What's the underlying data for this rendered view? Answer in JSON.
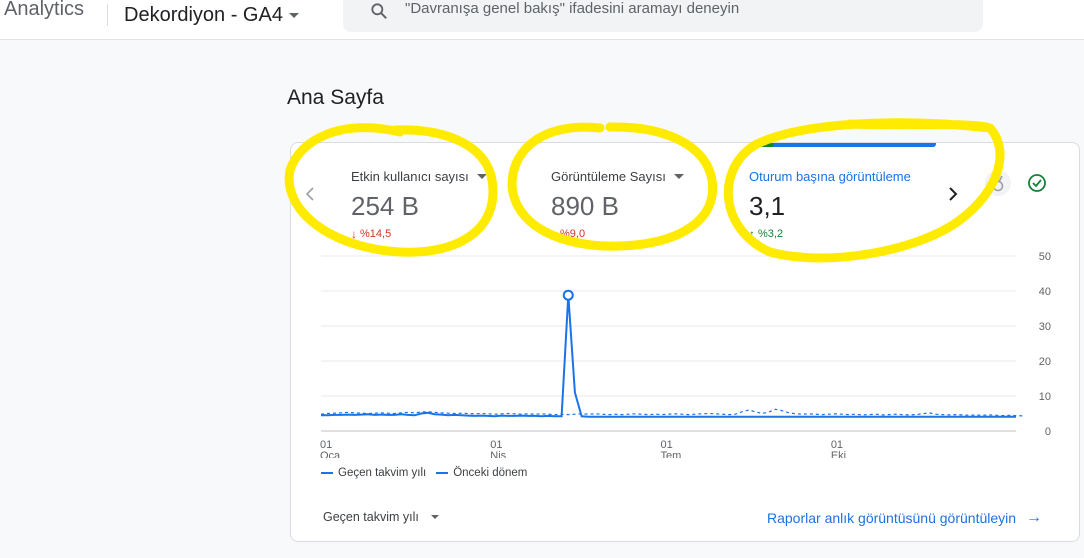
{
  "header": {
    "brand": "Analytics",
    "property_name": "Dekordiyon - GA4",
    "search_placeholder": "\"Davranışa genel bakış\" ifadesini aramayı deneyin"
  },
  "page": {
    "title": "Ana Sayfa"
  },
  "metrics": [
    {
      "label": "Etkin kullanıcı sayısı",
      "value": "254 B",
      "change": "%14,5",
      "direction": "down"
    },
    {
      "label": "Görüntüleme Sayısı",
      "value": "890 B",
      "change": "%9,0",
      "direction": "down"
    },
    {
      "label": "Oturum başına görüntüleme",
      "value": "3,1",
      "change": "%3,2",
      "direction": "up"
    }
  ],
  "chart_data": {
    "type": "line",
    "x_ticks": [
      {
        "day": "01",
        "month": "Oca"
      },
      {
        "day": "01",
        "month": "Nis"
      },
      {
        "day": "01",
        "month": "Tem"
      },
      {
        "day": "01",
        "month": "Eki"
      }
    ],
    "y_ticks": [
      "50",
      "40",
      "30",
      "20",
      "10",
      "0"
    ],
    "ylim": [
      0,
      50
    ],
    "grid": true,
    "legend_placement": "bottom-left",
    "series": [
      {
        "name": "Geçen takvim yılı",
        "style": "solid",
        "color": "#1a73e8",
        "values": [
          4.5,
          4.5,
          4.6,
          4.6,
          4.7,
          4.6,
          4.7,
          4.8,
          4.6,
          4.7,
          4.6,
          4.6,
          4.8,
          4.6,
          4.5,
          5.0,
          5.2,
          4.8,
          4.7,
          4.5,
          4.6,
          4.5,
          4.4,
          4.3,
          4.4,
          4.3,
          4.2,
          4.4,
          4.3,
          4.3,
          4.4,
          4.3,
          4.3,
          4.2,
          4.3,
          4.2,
          4.2,
          38.8,
          11,
          4.2,
          4.1,
          4.1,
          4.1,
          4.1,
          4.1,
          4.1,
          4.1,
          4.1,
          4.1,
          4.1,
          4.1,
          4.1,
          4.1,
          4.1,
          4.1,
          4.1,
          4.1,
          4.1,
          4.1,
          4.1,
          4.1,
          4.1,
          4.1,
          4.1,
          4.1,
          4.1,
          4.1,
          4.1,
          4.1,
          4.1,
          4.1,
          4.1,
          4.1,
          4.1,
          4.1,
          4.1,
          4.1,
          4.1,
          4.1,
          4.1,
          4.1,
          4.1,
          4.1,
          4.1,
          4.1,
          4.1,
          4.1,
          4.1,
          4.1,
          4.1,
          4.1,
          4.1,
          4.1,
          4.1,
          4.1,
          4.1,
          4.1,
          4.1,
          4.1,
          4.1,
          4.1,
          4.1,
          4.1,
          4.1,
          4.1
        ],
        "peak_index": 37
      },
      {
        "name": "Önceki dönem",
        "style": "dashed",
        "color": "#1a73e8",
        "values": [
          4.8,
          5.0,
          5.1,
          5.2,
          5.3,
          5.2,
          5.1,
          5.0,
          5.1,
          5.2,
          5.1,
          5.0,
          5.2,
          5.3,
          5.2,
          5.4,
          5.5,
          5.3,
          5.2,
          5.1,
          5.0,
          5.1,
          5.0,
          4.9,
          5.0,
          4.9,
          4.8,
          4.9,
          5.0,
          4.9,
          4.8,
          4.9,
          4.8,
          4.9,
          4.8,
          4.7,
          4.8,
          4.7,
          4.8,
          4.9,
          4.8,
          4.9,
          4.8,
          4.7,
          4.8,
          4.7,
          4.8,
          4.9,
          4.8,
          4.7,
          4.8,
          4.7,
          4.8,
          4.9,
          4.8,
          4.7,
          4.8,
          4.9,
          5.0,
          4.9,
          4.8,
          4.7,
          4.8,
          5.5,
          6.0,
          5.5,
          5.0,
          5.4,
          6.2,
          5.8,
          5.2,
          4.9,
          4.8,
          4.9,
          4.8,
          4.7,
          4.8,
          4.9,
          4.8,
          4.7,
          4.8,
          4.6,
          4.7,
          4.8,
          4.6,
          4.7,
          4.8,
          4.7,
          4.6,
          4.7,
          4.9,
          5.2,
          4.8,
          4.7,
          4.6,
          4.7,
          4.6,
          4.5,
          4.6,
          4.5,
          4.6,
          4.5,
          4.4,
          4.5,
          4.4,
          4.3
        ]
      }
    ]
  },
  "footer": {
    "period_label": "Geçen takvim yılı",
    "report_link": "Raporlar anlık görüntüsünü görüntüleyin"
  },
  "colors": {
    "accent": "#1a73e8",
    "down": "#d93025",
    "up": "#188038",
    "highlight": "#ffeb00"
  }
}
